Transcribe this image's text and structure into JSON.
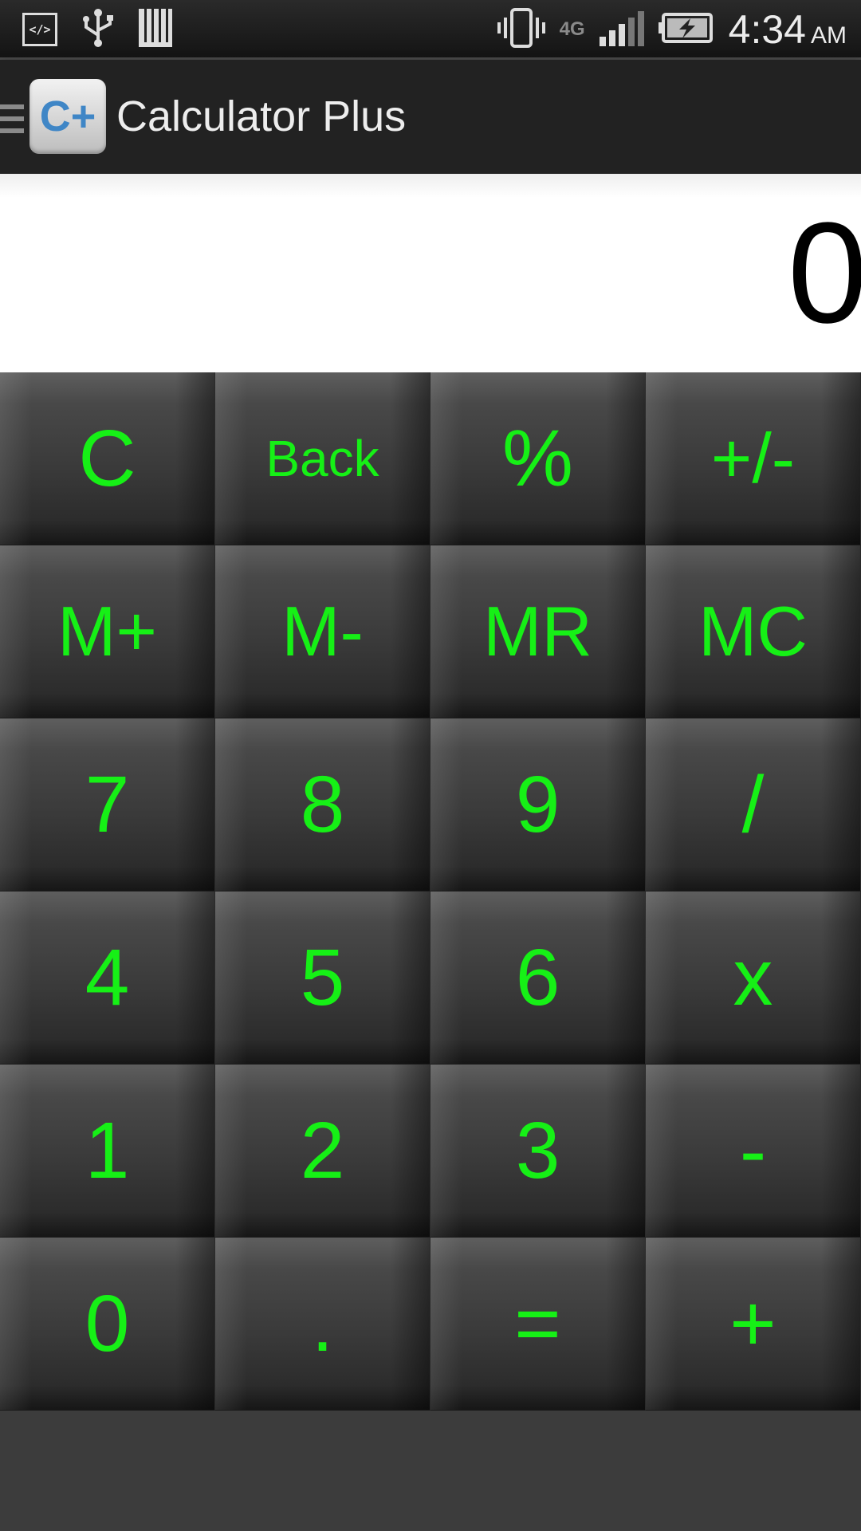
{
  "status_bar": {
    "time": "4:34",
    "ampm": "AM",
    "network": "4G",
    "dev_icon_text": "</>"
  },
  "app_bar": {
    "title": "Calculator Plus",
    "icon_text": "C+"
  },
  "display": {
    "value": "0"
  },
  "keys": {
    "r1": [
      "C",
      "Back",
      "%",
      "+/-"
    ],
    "r2": [
      "M+",
      "M-",
      "MR",
      "MC"
    ],
    "r3": [
      "7",
      "8",
      "9",
      "/"
    ],
    "r4": [
      "4",
      "5",
      "6",
      "x"
    ],
    "r5": [
      "1",
      "2",
      "3",
      "-"
    ],
    "r6": [
      "0",
      ".",
      "=",
      "+"
    ]
  },
  "colors": {
    "key_text": "#16f016",
    "key_bg": "#3a3a3a",
    "app_bar_bg": "#222222",
    "display_bg": "#ffffff"
  }
}
